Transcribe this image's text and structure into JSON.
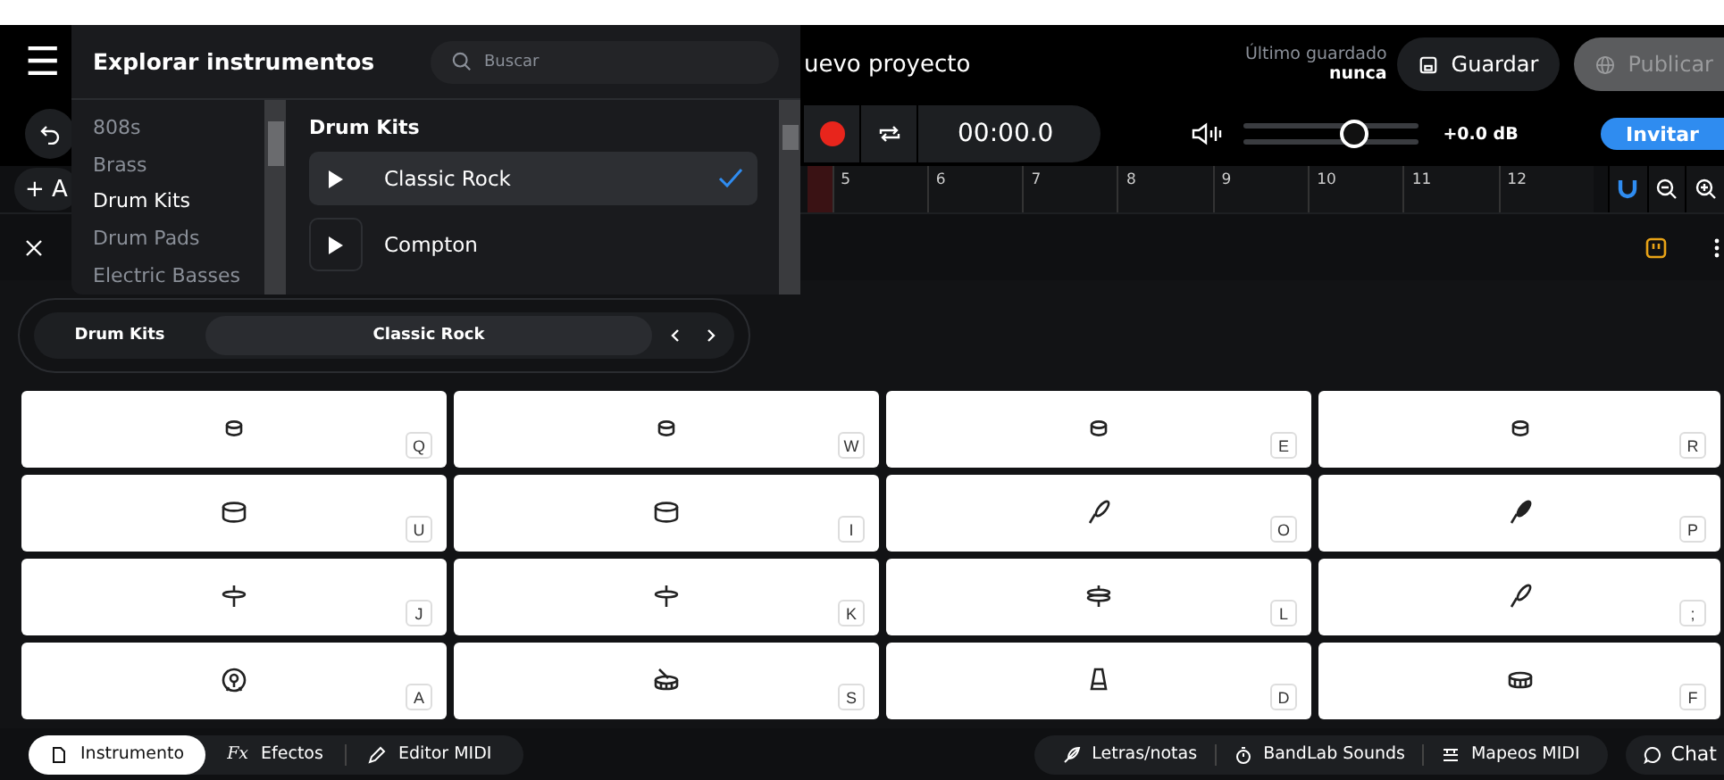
{
  "header": {
    "menu_label": "☰",
    "project_title": "uevo proyecto",
    "last_saved_label": "Último guardado",
    "last_saved_value": "nunca",
    "save_button": "Guardar",
    "publish_button": "Publicar"
  },
  "transport": {
    "time": "00:00.0",
    "volume": {
      "level": 0.64,
      "reading": "+0.0 dB"
    },
    "invite_button": "Invitar"
  },
  "track_button": "+ A",
  "ruler": {
    "marks": [
      "5",
      "6",
      "7",
      "8",
      "9",
      "10",
      "11",
      "12"
    ]
  },
  "instrument_bar": {
    "category": "Drum Kits",
    "preset": "Classic Rock"
  },
  "menu_panel": {
    "title": "Explorar instrumentos",
    "search": {
      "placeholder": "Buscar"
    },
    "categories": [
      {
        "label": "808s",
        "selected": false
      },
      {
        "label": "Brass",
        "selected": false
      },
      {
        "label": "Drum Kits",
        "selected": true
      },
      {
        "label": "Drum Pads",
        "selected": false
      },
      {
        "label": "Electric Basses",
        "selected": false
      }
    ],
    "section_title": "Drum Kits",
    "presets": [
      {
        "label": "Classic Rock",
        "selected": true
      },
      {
        "label": "Compton",
        "selected": false
      }
    ]
  },
  "pads": [
    {
      "kind": "tom-small",
      "key": "Q"
    },
    {
      "kind": "tom-small",
      "key": "W"
    },
    {
      "kind": "tom-small",
      "key": "E"
    },
    {
      "kind": "tom-small",
      "key": "R"
    },
    {
      "kind": "tom",
      "key": "U"
    },
    {
      "kind": "tom",
      "key": "I"
    },
    {
      "kind": "cymbal",
      "key": "O"
    },
    {
      "kind": "cymbal-filled",
      "key": "P"
    },
    {
      "kind": "hihat",
      "key": "J"
    },
    {
      "kind": "hihat",
      "key": "K"
    },
    {
      "kind": "hihat-closed",
      "key": "L"
    },
    {
      "kind": "cymbal",
      "key": ";"
    },
    {
      "kind": "kick",
      "key": "A"
    },
    {
      "kind": "snare",
      "key": "S"
    },
    {
      "kind": "cowbell",
      "key": "D"
    },
    {
      "kind": "drum",
      "key": "F"
    }
  ],
  "bottom_bar": {
    "tabs": [
      {
        "label": "Instrumento",
        "selected": true,
        "kind": "instrument"
      },
      {
        "label": "Efectos",
        "selected": false,
        "kind": "effects",
        "icon_text": "Fx"
      },
      {
        "label": "Editor MIDI",
        "selected": false,
        "kind": "editor"
      }
    ],
    "tools": [
      "Letras/notas",
      "BandLab Sounds",
      "Mapeos MIDI"
    ],
    "chat_button": "Chat"
  }
}
